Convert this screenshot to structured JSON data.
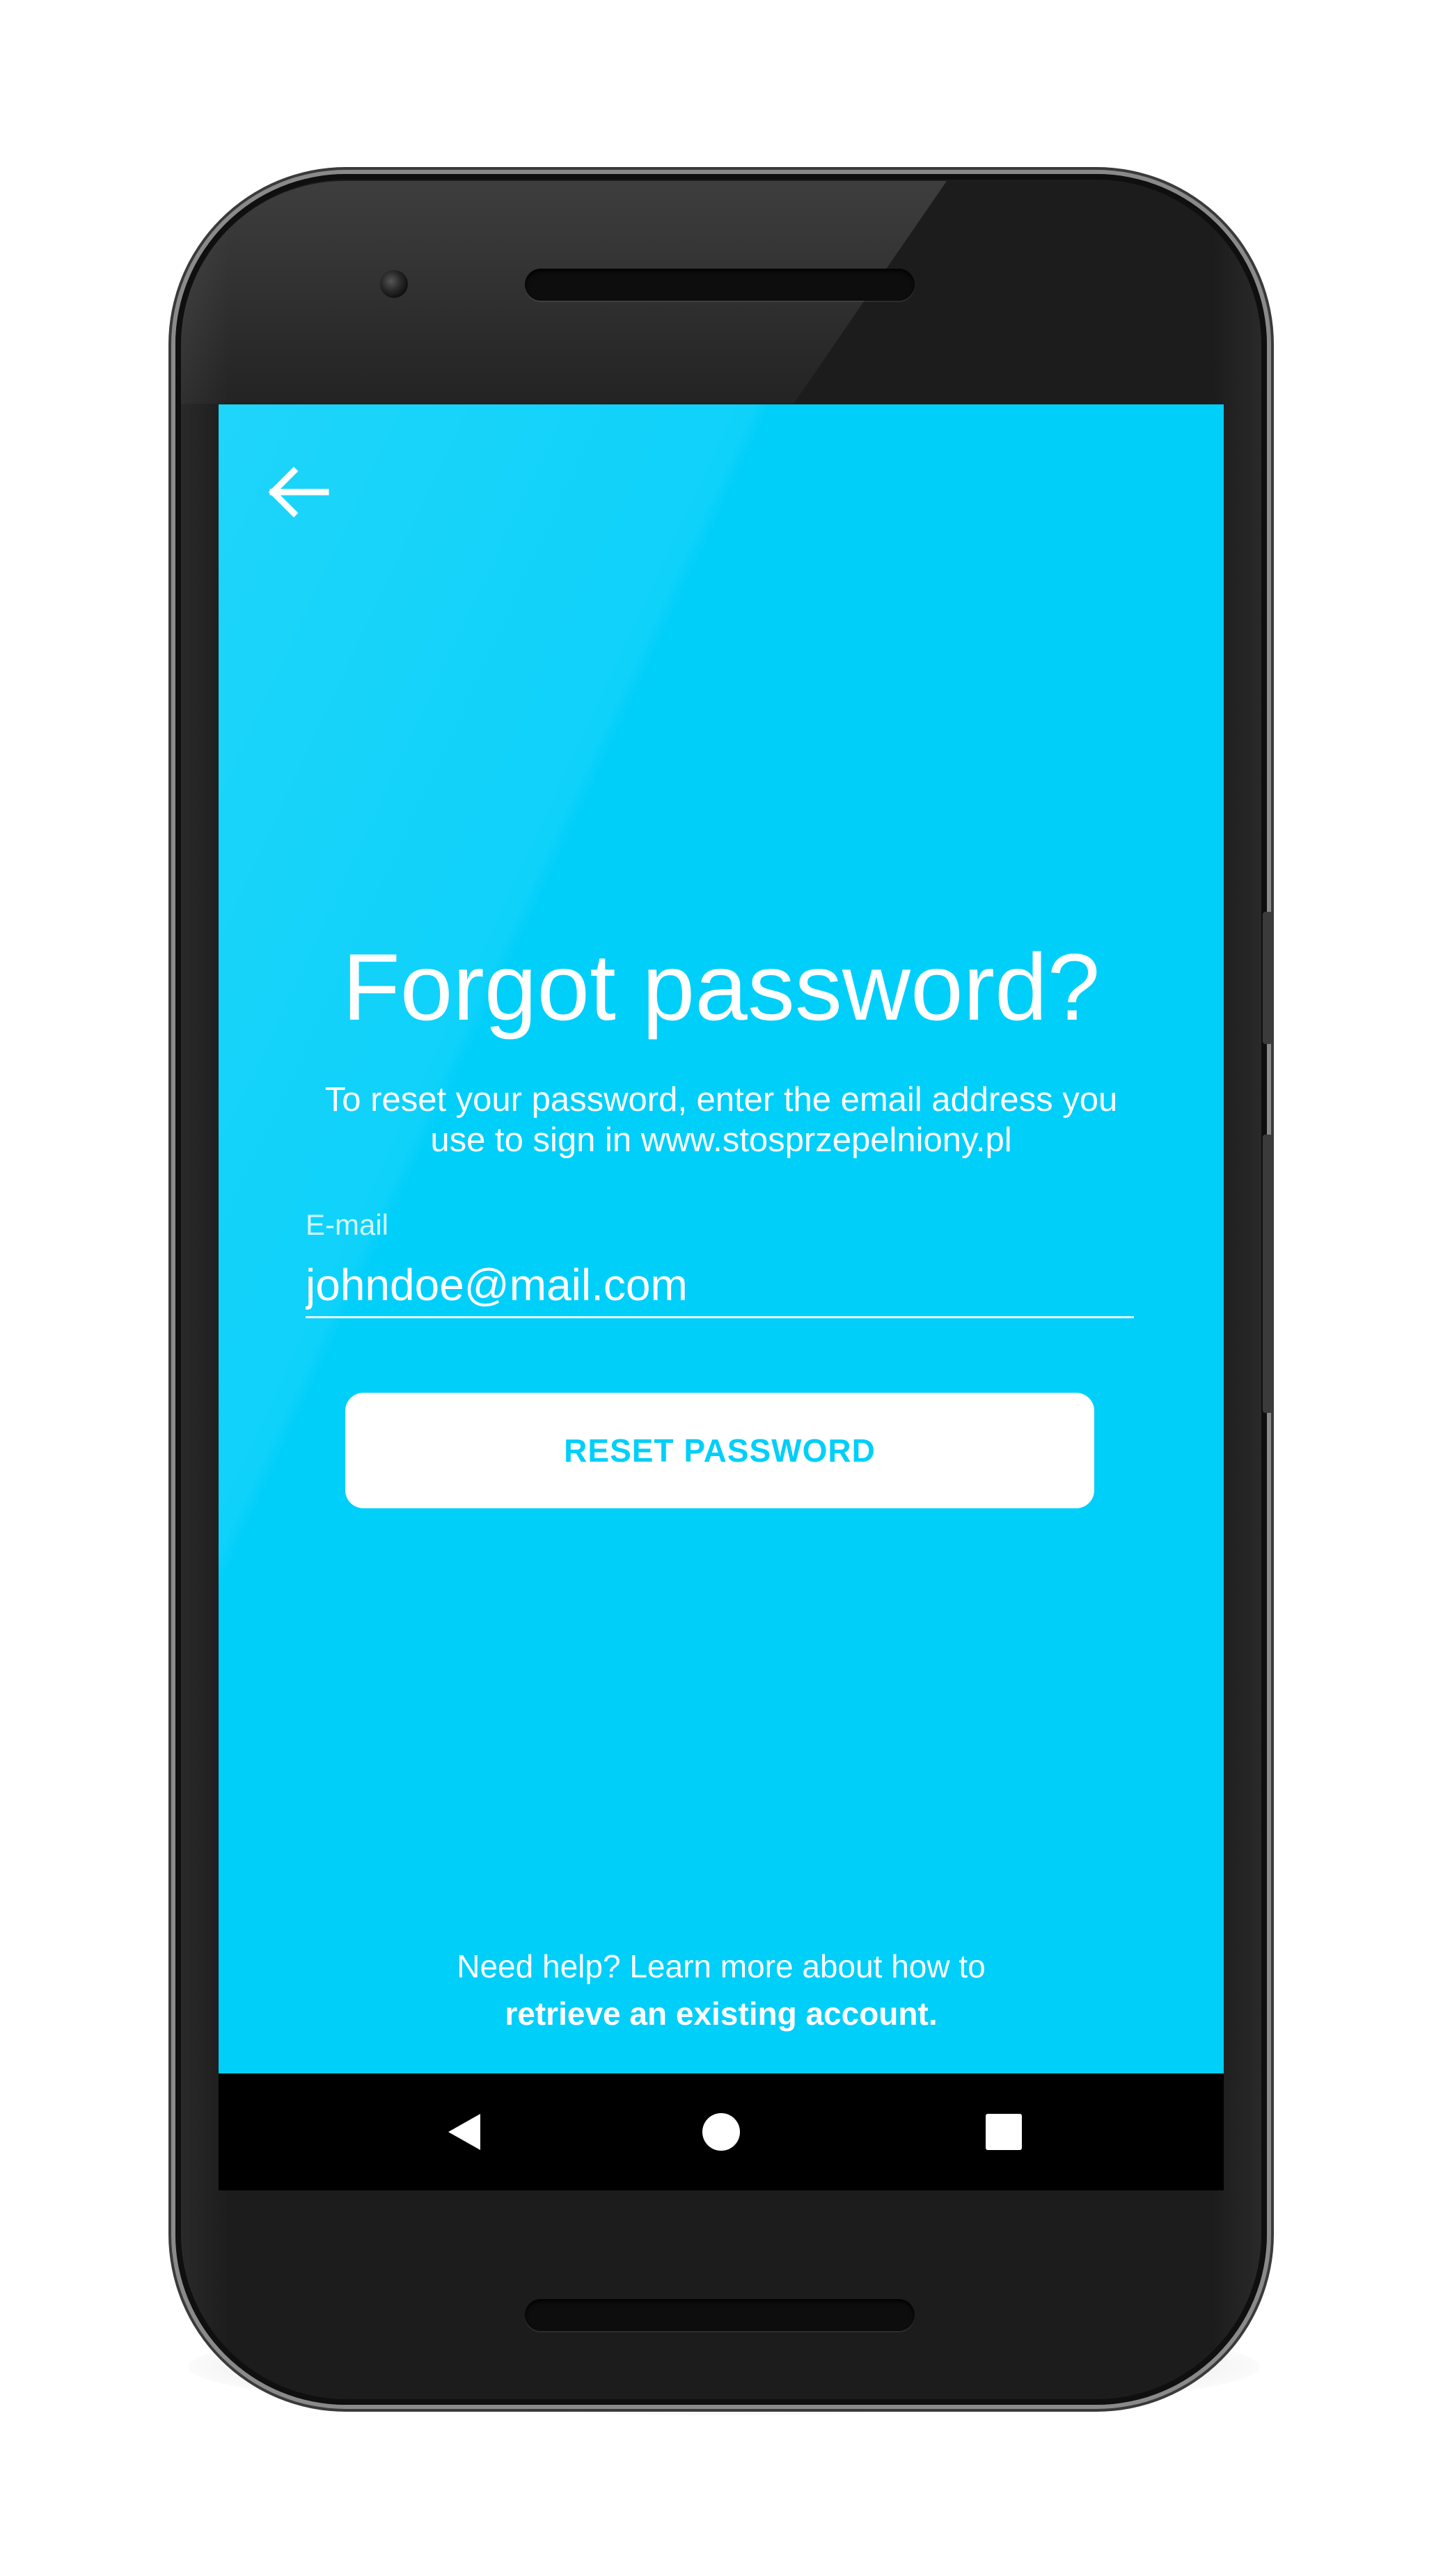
{
  "screen": {
    "background_color": "#00cffa",
    "back_icon": "arrow-left-icon",
    "title": "Forgot password?",
    "subtitle_line1": "To reset your password, enter the email address you",
    "subtitle_line2": "use to sign in www.stosprzepelniony.pl",
    "email_label": "E-mail",
    "email_value": "johndoe@mail.com",
    "reset_button_label": "RESET PASSWORD",
    "help_text": "Need help? Learn more about how to",
    "help_link": "retrieve an existing account."
  },
  "navbar": {
    "back_icon": "triangle-back-icon",
    "home_icon": "circle-home-icon",
    "recents_icon": "square-recents-icon"
  }
}
